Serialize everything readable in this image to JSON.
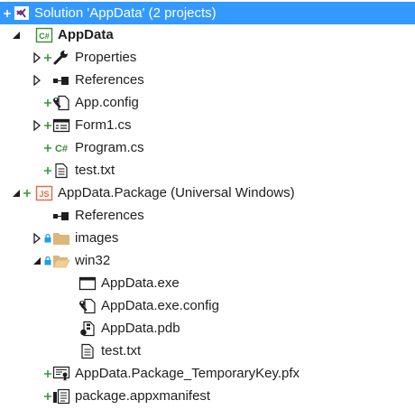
{
  "solution_explorer": {
    "solution_label": "Solution 'AppData' (2 projects)",
    "projects": [
      {
        "name": "AppData",
        "items": [
          {
            "label": "Properties",
            "icon": "wrench-icon"
          },
          {
            "label": "References",
            "icon": "references-icon"
          },
          {
            "label": "App.config",
            "icon": "config-file-icon"
          },
          {
            "label": "Form1.cs",
            "icon": "form-icon"
          },
          {
            "label": "Program.cs",
            "icon": "csharp-file-icon"
          },
          {
            "label": "test.txt",
            "icon": "text-file-icon"
          }
        ]
      },
      {
        "name": "AppData.Package (Universal Windows)",
        "items": [
          {
            "label": "References",
            "icon": "references-icon"
          },
          {
            "label": "images",
            "icon": "folder-icon"
          },
          {
            "label": "win32",
            "icon": "folder-open-icon"
          },
          {
            "label": "AppData.exe",
            "icon": "window-file-icon"
          },
          {
            "label": "AppData.exe.config",
            "icon": "config-file-icon"
          },
          {
            "label": "AppData.pdb",
            "icon": "pdb-file-icon"
          },
          {
            "label": "test.txt",
            "icon": "text-file-icon"
          },
          {
            "label": "AppData.Package_TemporaryKey.pfx",
            "icon": "certificate-icon"
          },
          {
            "label": "package.appxmanifest",
            "icon": "manifest-icon"
          }
        ]
      }
    ]
  },
  "colors": {
    "selection": "#3399ff",
    "source_control_plus": "#339933",
    "folder": "#dcb67a",
    "lock": "#1ba1e2",
    "csharp": "#388a34",
    "js": "#e8663d"
  }
}
